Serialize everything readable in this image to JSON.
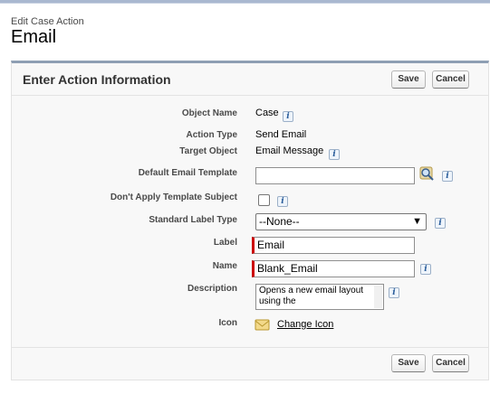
{
  "header": {
    "subtitle": "Edit Case Action",
    "title": "Email"
  },
  "panel": {
    "title": "Enter Action Information",
    "save_label": "Save",
    "cancel_label": "Cancel"
  },
  "fields": {
    "object_name": {
      "label": "Object Name",
      "value": "Case"
    },
    "action_type": {
      "label": "Action Type",
      "value": "Send Email"
    },
    "target_object": {
      "label": "Target Object",
      "value": "Email Message"
    },
    "default_email_template": {
      "label": "Default Email Template",
      "value": ""
    },
    "dont_apply_template_subject": {
      "label": "Don't Apply Template Subject",
      "checked": false
    },
    "standard_label_type": {
      "label": "Standard Label Type",
      "value": "--None--"
    },
    "label": {
      "label": "Label",
      "value": "Email"
    },
    "name": {
      "label": "Name",
      "value": "Blank_Email"
    },
    "description": {
      "label": "Description",
      "value": "Opens a new email layout using the"
    },
    "icon": {
      "label": "Icon",
      "link": "Change Icon"
    }
  },
  "info_glyph": "i",
  "icons": {
    "lookup": "magnifier-lookup-icon",
    "action_icon": "envelope-icon",
    "info": "info-icon"
  }
}
